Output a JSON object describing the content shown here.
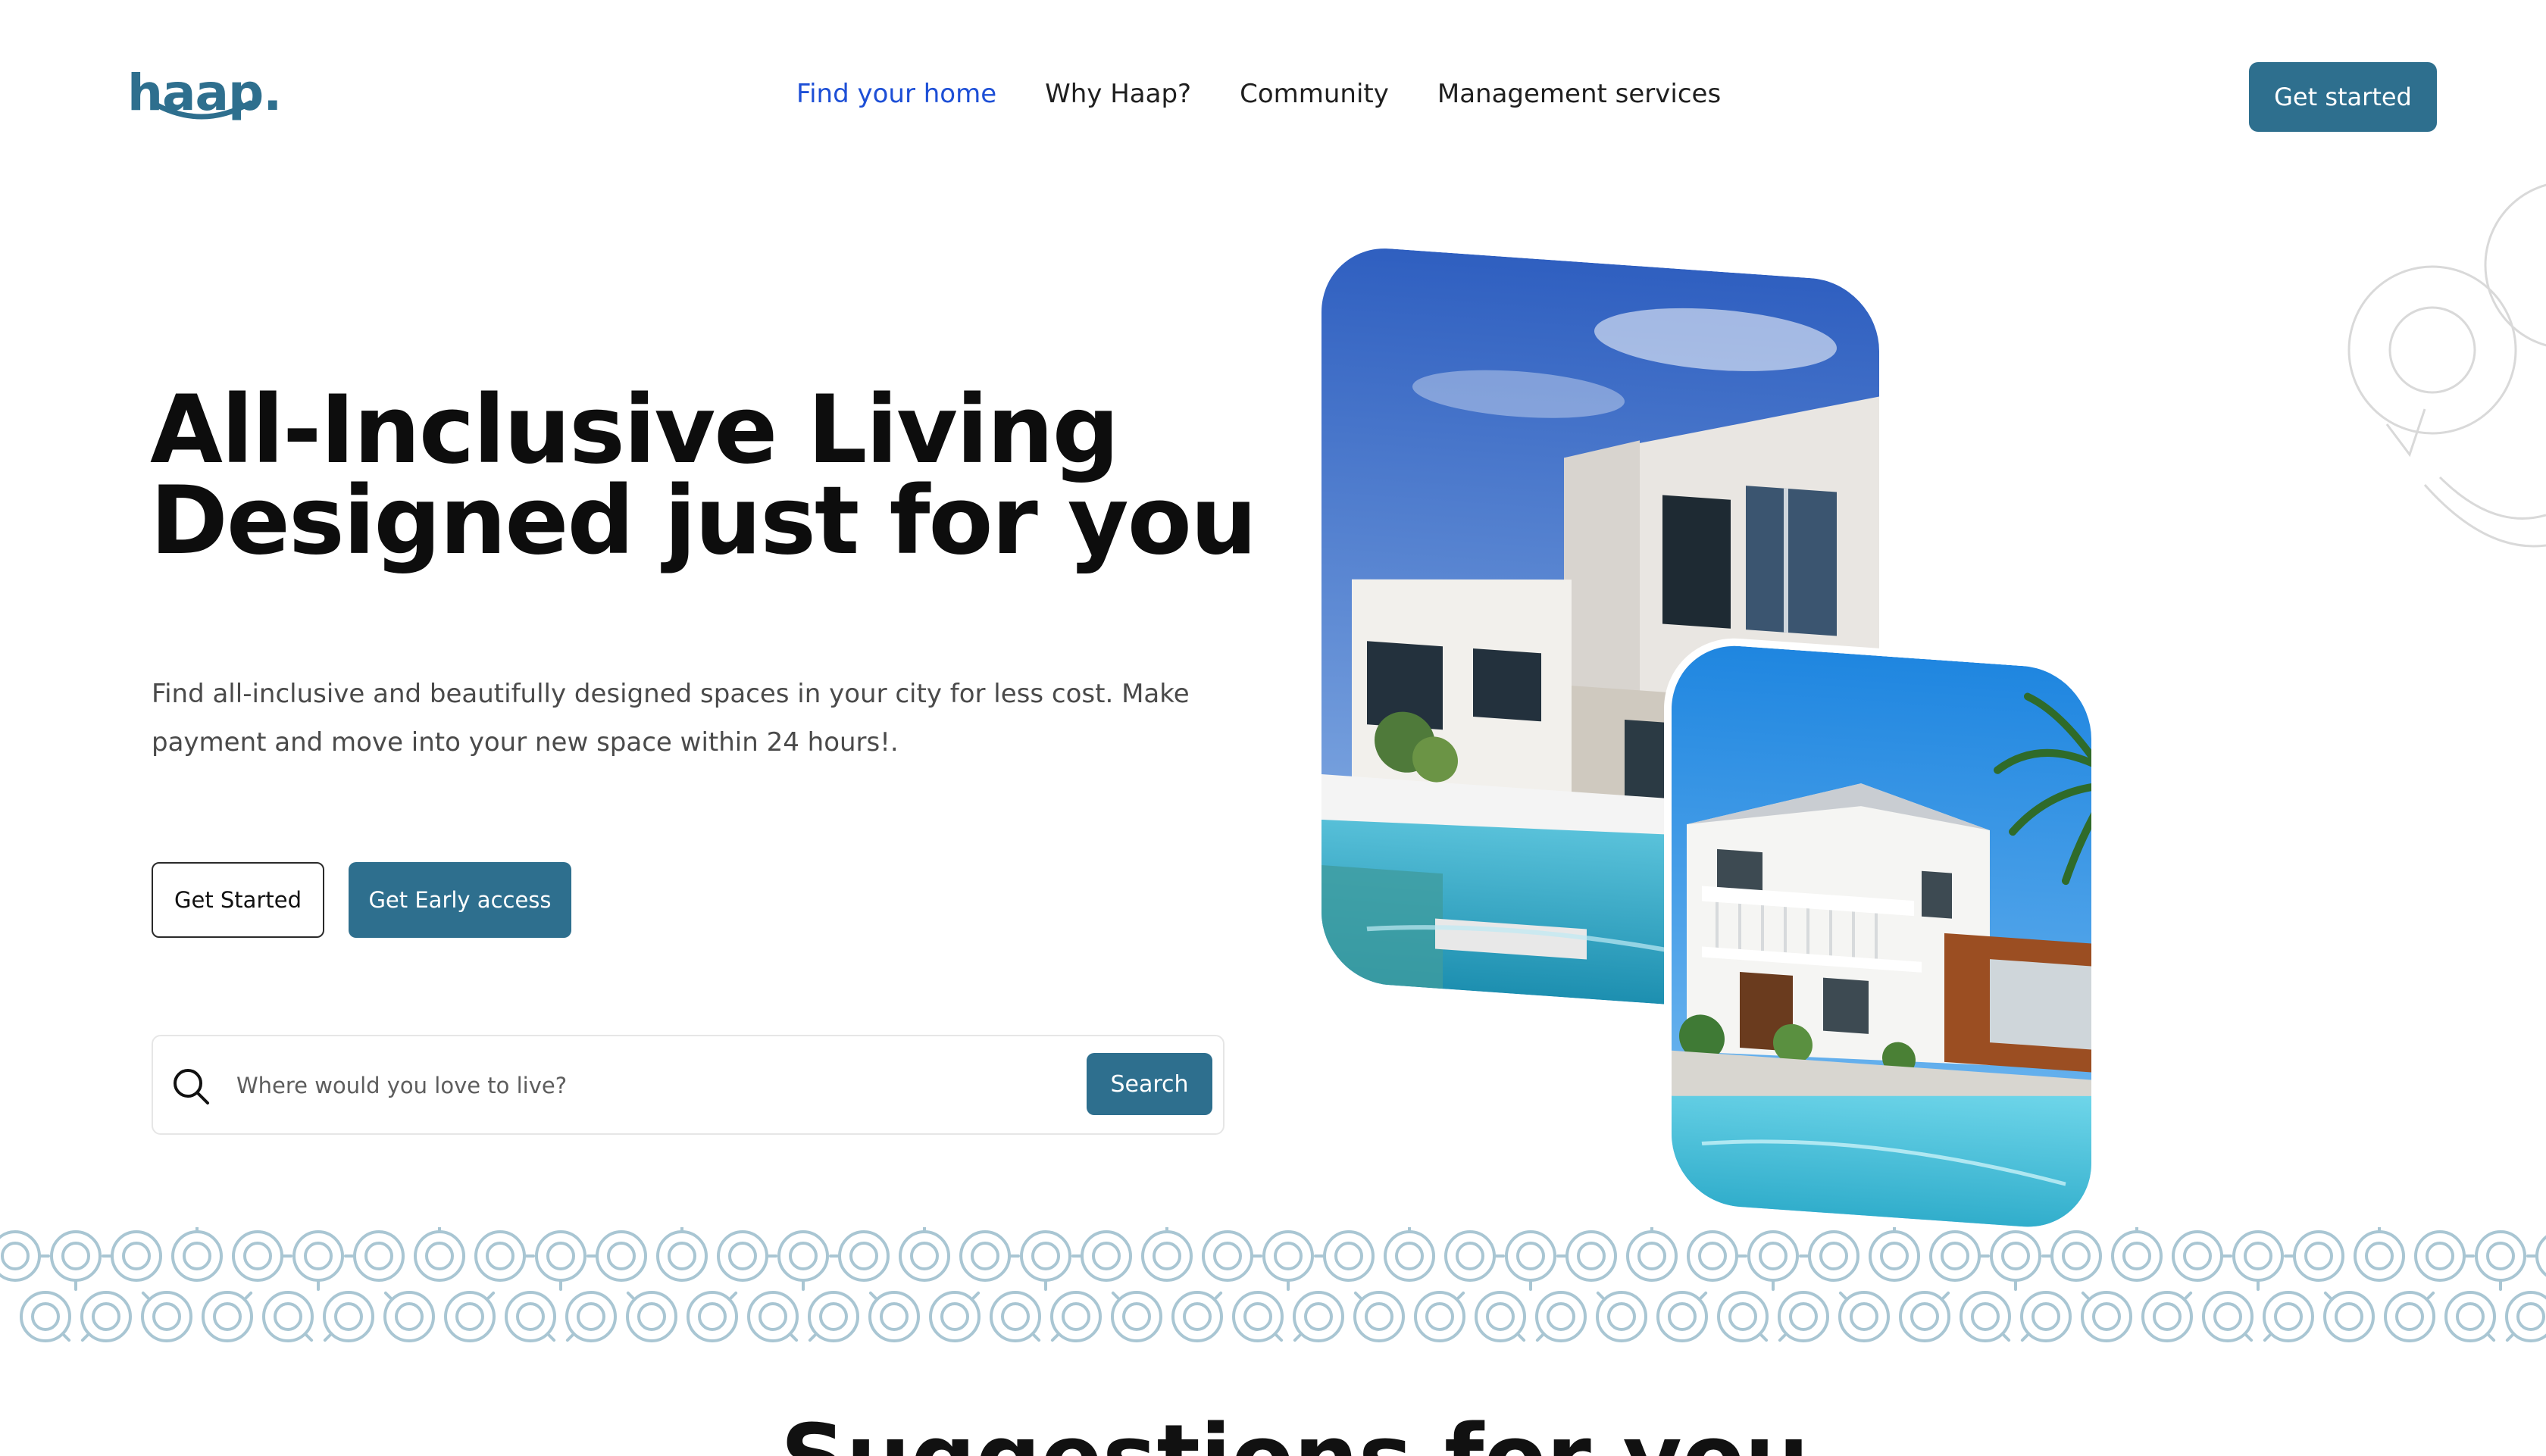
{
  "brand": {
    "logo_text": "haap."
  },
  "nav": {
    "items": [
      {
        "label": "Find your home"
      },
      {
        "label": "Why Haap?"
      },
      {
        "label": "Community"
      },
      {
        "label": "Management services"
      }
    ],
    "cta_label": "Get started"
  },
  "hero": {
    "title_line1": "All-Inclusive Living",
    "title_line2": "Designed just for you",
    "subtitle": "Find all-inclusive and beautifully designed spaces in your city for less cost. Make payment and move into your new space within 24 hours!.",
    "primary_outline_label": "Get Started",
    "primary_fill_label": "Get Early access"
  },
  "search": {
    "placeholder": "Where would you love to live?",
    "button_label": "Search"
  },
  "suggestions": {
    "title": "Suggestions for you"
  },
  "colors": {
    "accent": "#2e6f8e",
    "nav_active": "#1d4fd6",
    "pattern": "#a9c6d3"
  }
}
